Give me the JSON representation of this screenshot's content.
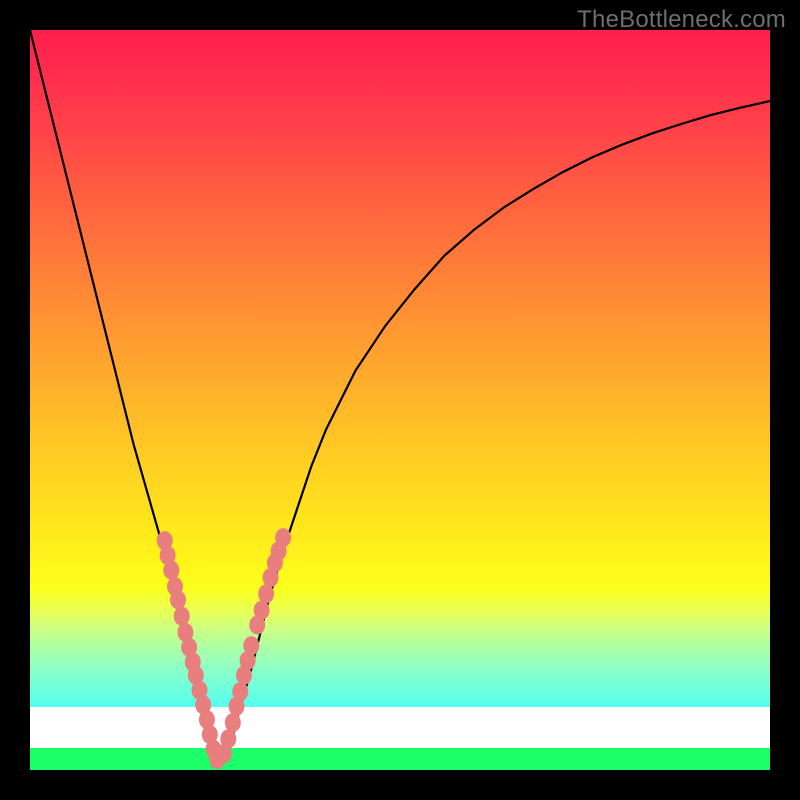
{
  "watermark": "TheBottleneck.com",
  "chart_data": {
    "type": "line",
    "title": "",
    "xlabel": "",
    "ylabel": "",
    "xlim": [
      0,
      100
    ],
    "ylim": [
      0,
      100
    ],
    "series": [
      {
        "name": "bottleneck-curve",
        "x": [
          0,
          2,
          4,
          6,
          8,
          10,
          12,
          14,
          16,
          18,
          20,
          22,
          24,
          25,
          26,
          27,
          28,
          30,
          32,
          34,
          36,
          38,
          40,
          44,
          48,
          52,
          56,
          60,
          64,
          68,
          72,
          76,
          80,
          84,
          88,
          92,
          96,
          100
        ],
        "values": [
          100,
          92,
          84,
          76,
          68,
          60,
          52,
          44,
          37,
          30,
          23,
          16,
          8,
          3,
          1,
          3,
          7,
          14,
          22,
          29,
          35,
          41,
          46,
          54,
          60,
          65,
          69.5,
          73,
          76,
          78.5,
          80.8,
          82.8,
          84.5,
          86,
          87.3,
          88.5,
          89.5,
          90.4
        ]
      }
    ],
    "beads": [
      {
        "x": 18.2,
        "y": 31.0
      },
      {
        "x": 18.6,
        "y": 29.0
      },
      {
        "x": 19.1,
        "y": 27.0
      },
      {
        "x": 19.6,
        "y": 24.8
      },
      {
        "x": 20.0,
        "y": 23.0
      },
      {
        "x": 20.5,
        "y": 20.8
      },
      {
        "x": 21.0,
        "y": 18.6
      },
      {
        "x": 21.5,
        "y": 16.6
      },
      {
        "x": 22.0,
        "y": 14.6
      },
      {
        "x": 22.4,
        "y": 12.8
      },
      {
        "x": 22.9,
        "y": 10.8
      },
      {
        "x": 23.4,
        "y": 8.8
      },
      {
        "x": 23.9,
        "y": 6.8
      },
      {
        "x": 24.3,
        "y": 4.8
      },
      {
        "x": 24.8,
        "y": 2.8
      },
      {
        "x": 25.3,
        "y": 1.4
      },
      {
        "x": 26.2,
        "y": 2.2
      },
      {
        "x": 26.8,
        "y": 4.2
      },
      {
        "x": 27.4,
        "y": 6.4
      },
      {
        "x": 27.9,
        "y": 8.6
      },
      {
        "x": 28.4,
        "y": 10.6
      },
      {
        "x": 28.9,
        "y": 12.8
      },
      {
        "x": 29.4,
        "y": 14.8
      },
      {
        "x": 29.9,
        "y": 16.8
      },
      {
        "x": 30.7,
        "y": 19.6
      },
      {
        "x": 31.3,
        "y": 21.6
      },
      {
        "x": 31.9,
        "y": 23.8
      },
      {
        "x": 32.5,
        "y": 26.0
      },
      {
        "x": 33.1,
        "y": 28.0
      },
      {
        "x": 33.6,
        "y": 29.6
      },
      {
        "x": 34.2,
        "y": 31.4
      }
    ]
  }
}
